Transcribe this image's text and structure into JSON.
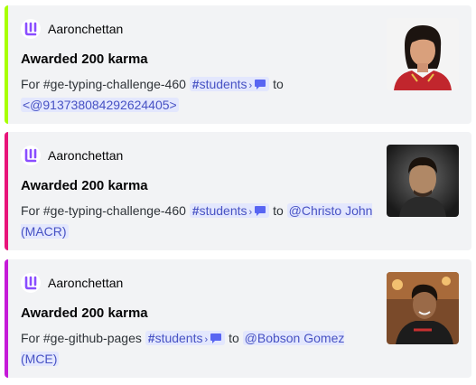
{
  "cards": [
    {
      "accent": "#a8ff00",
      "author": "Aaronchettan",
      "title": "Awarded 200 karma",
      "prefix": "For #ge-typing-challenge-460",
      "channel": "students",
      "to": "to",
      "recipient": "<@913738084292624405>",
      "thumbnail": "woman-portrait-photo"
    },
    {
      "accent": "#e8147a",
      "author": "Aaronchettan",
      "title": "Awarded 200 karma",
      "prefix": "For #ge-typing-challenge-460",
      "channel": "students",
      "to": "to",
      "recipient": "@Christo John (MACR)",
      "thumbnail": "man-portrait-photo"
    },
    {
      "accent": "#c51ad8",
      "author": "Aaronchettan",
      "title": "Awarded 200 karma",
      "prefix": "For #ge-github-pages",
      "channel": "students",
      "to": "to",
      "recipient": "@Bobson Gomez (MCE)",
      "thumbnail": "smiling-man-photo"
    }
  ]
}
